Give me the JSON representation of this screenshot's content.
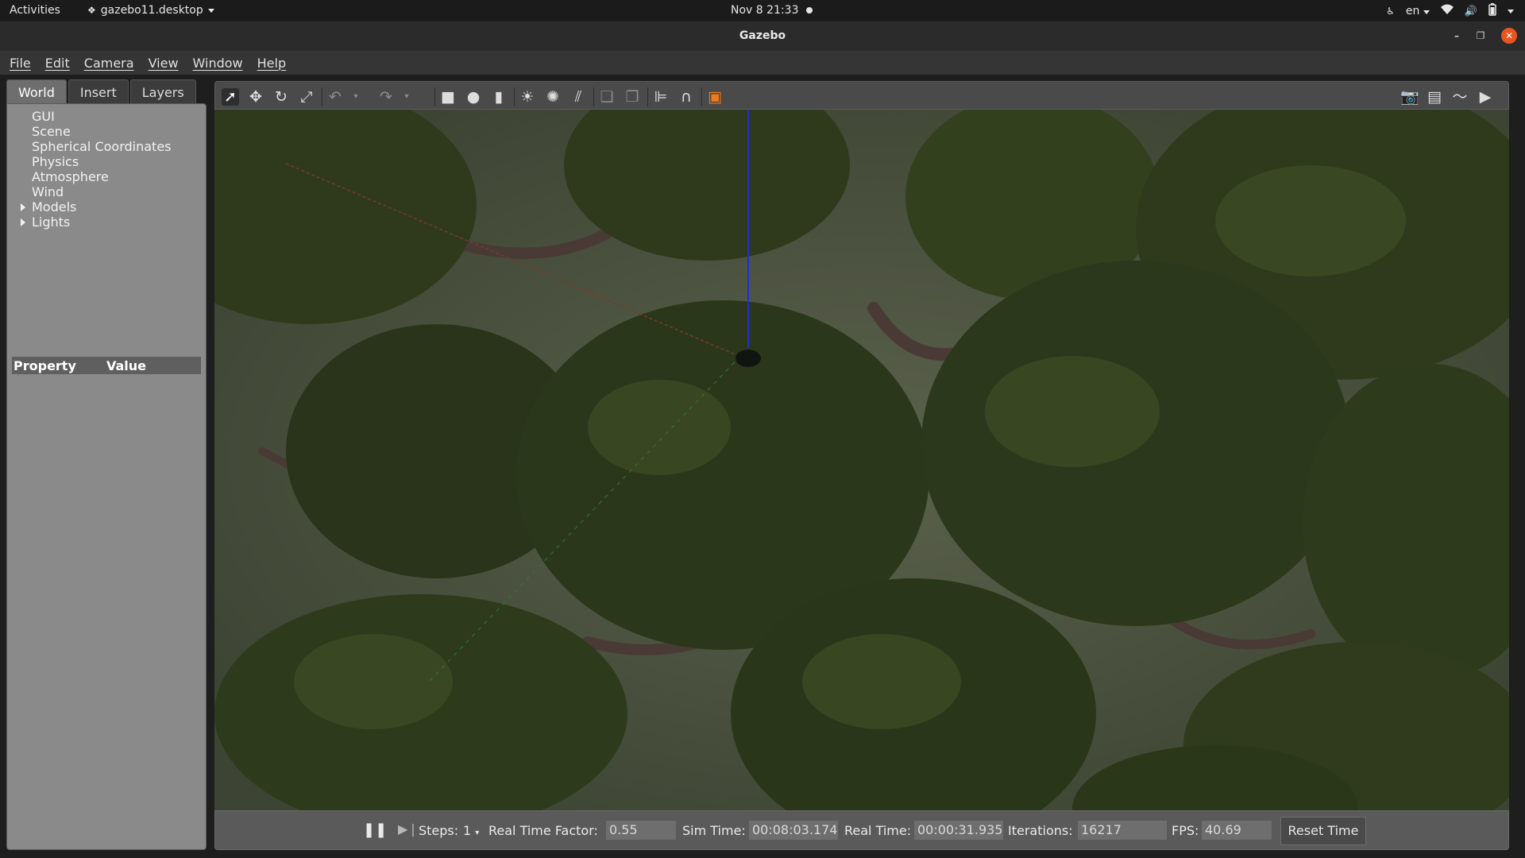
{
  "topbar": {
    "activities": "Activities",
    "app_name": "gazebo11.desktop",
    "clock": "Nov 8  21:33",
    "lang": "en"
  },
  "window": {
    "title": "Gazebo"
  },
  "menubar": {
    "items": [
      "File",
      "Edit",
      "Camera",
      "View",
      "Window",
      "Help"
    ]
  },
  "leftpanel": {
    "tabs": [
      "World",
      "Insert",
      "Layers"
    ],
    "active_tab": "World",
    "tree": [
      {
        "label": "GUI",
        "expandable": false
      },
      {
        "label": "Scene",
        "expandable": false
      },
      {
        "label": "Spherical Coordinates",
        "expandable": false
      },
      {
        "label": "Physics",
        "expandable": false
      },
      {
        "label": "Atmosphere",
        "expandable": false
      },
      {
        "label": "Wind",
        "expandable": false
      },
      {
        "label": "Models",
        "expandable": true
      },
      {
        "label": "Lights",
        "expandable": true
      }
    ],
    "property_header": {
      "property": "Property",
      "value": "Value"
    }
  },
  "toolbar": {
    "tools": [
      "select-mode",
      "translate-mode",
      "rotate-mode",
      "scale-mode",
      "undo",
      "undo-history",
      "redo",
      "redo-history",
      "box",
      "sphere",
      "cylinder",
      "point-light",
      "spot-light",
      "directional-light",
      "copy",
      "paste",
      "align",
      "snap",
      "change-view",
      "screenshot",
      "log-data",
      "plot",
      "record-video"
    ]
  },
  "bottombar": {
    "steps_label": "Steps:",
    "steps_value": "1",
    "rtf_label": "Real Time Factor:",
    "rtf_value": "0.55",
    "simtime_label": "Sim Time:",
    "simtime_value": "00:08:03.174",
    "realtime_label": "Real Time:",
    "realtime_value": "00:00:31.935",
    "iterations_label": "Iterations:",
    "iterations_value": "16217",
    "fps_label": "FPS:",
    "fps_value": "40.69",
    "reset_label": "Reset Time"
  },
  "colors": {
    "accent_close": "#e95420",
    "foliage": "#2f3a1c",
    "ground": "#4b5340",
    "z_axis": "#1f2fd6"
  }
}
